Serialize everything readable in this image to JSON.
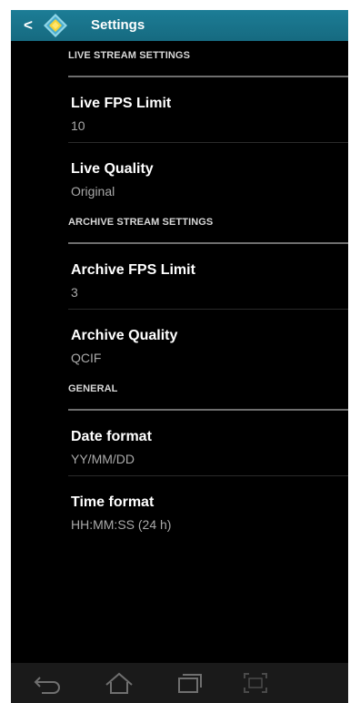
{
  "actionbar": {
    "back_icon": "chevron-left-icon",
    "app_icon": "diamond-app-icon",
    "title": "Settings"
  },
  "sections": [
    {
      "label": "LIVE STREAM SETTINGS",
      "items": [
        {
          "title": "Live FPS Limit",
          "summary": "10"
        },
        {
          "title": "Live Quality",
          "summary": "Original"
        }
      ]
    },
    {
      "label": "ARCHIVE STREAM SETTINGS",
      "items": [
        {
          "title": "Archive FPS Limit",
          "summary": "3"
        },
        {
          "title": "Archive Quality",
          "summary": "QCIF"
        }
      ]
    },
    {
      "label": "GENERAL",
      "items": [
        {
          "title": "Date format",
          "summary": "YY/MM/DD"
        },
        {
          "title": "Time format",
          "summary": "HH:MM:SS (24 h)"
        }
      ]
    }
  ],
  "navbar": {
    "icons": [
      "back-icon",
      "home-icon",
      "recent-apps-icon",
      "screenshot-icon"
    ]
  },
  "colors": {
    "actionbar": "#1a7890",
    "background": "#000000",
    "section_text": "#d8d8d8",
    "summary_text": "#a9a9a9"
  }
}
